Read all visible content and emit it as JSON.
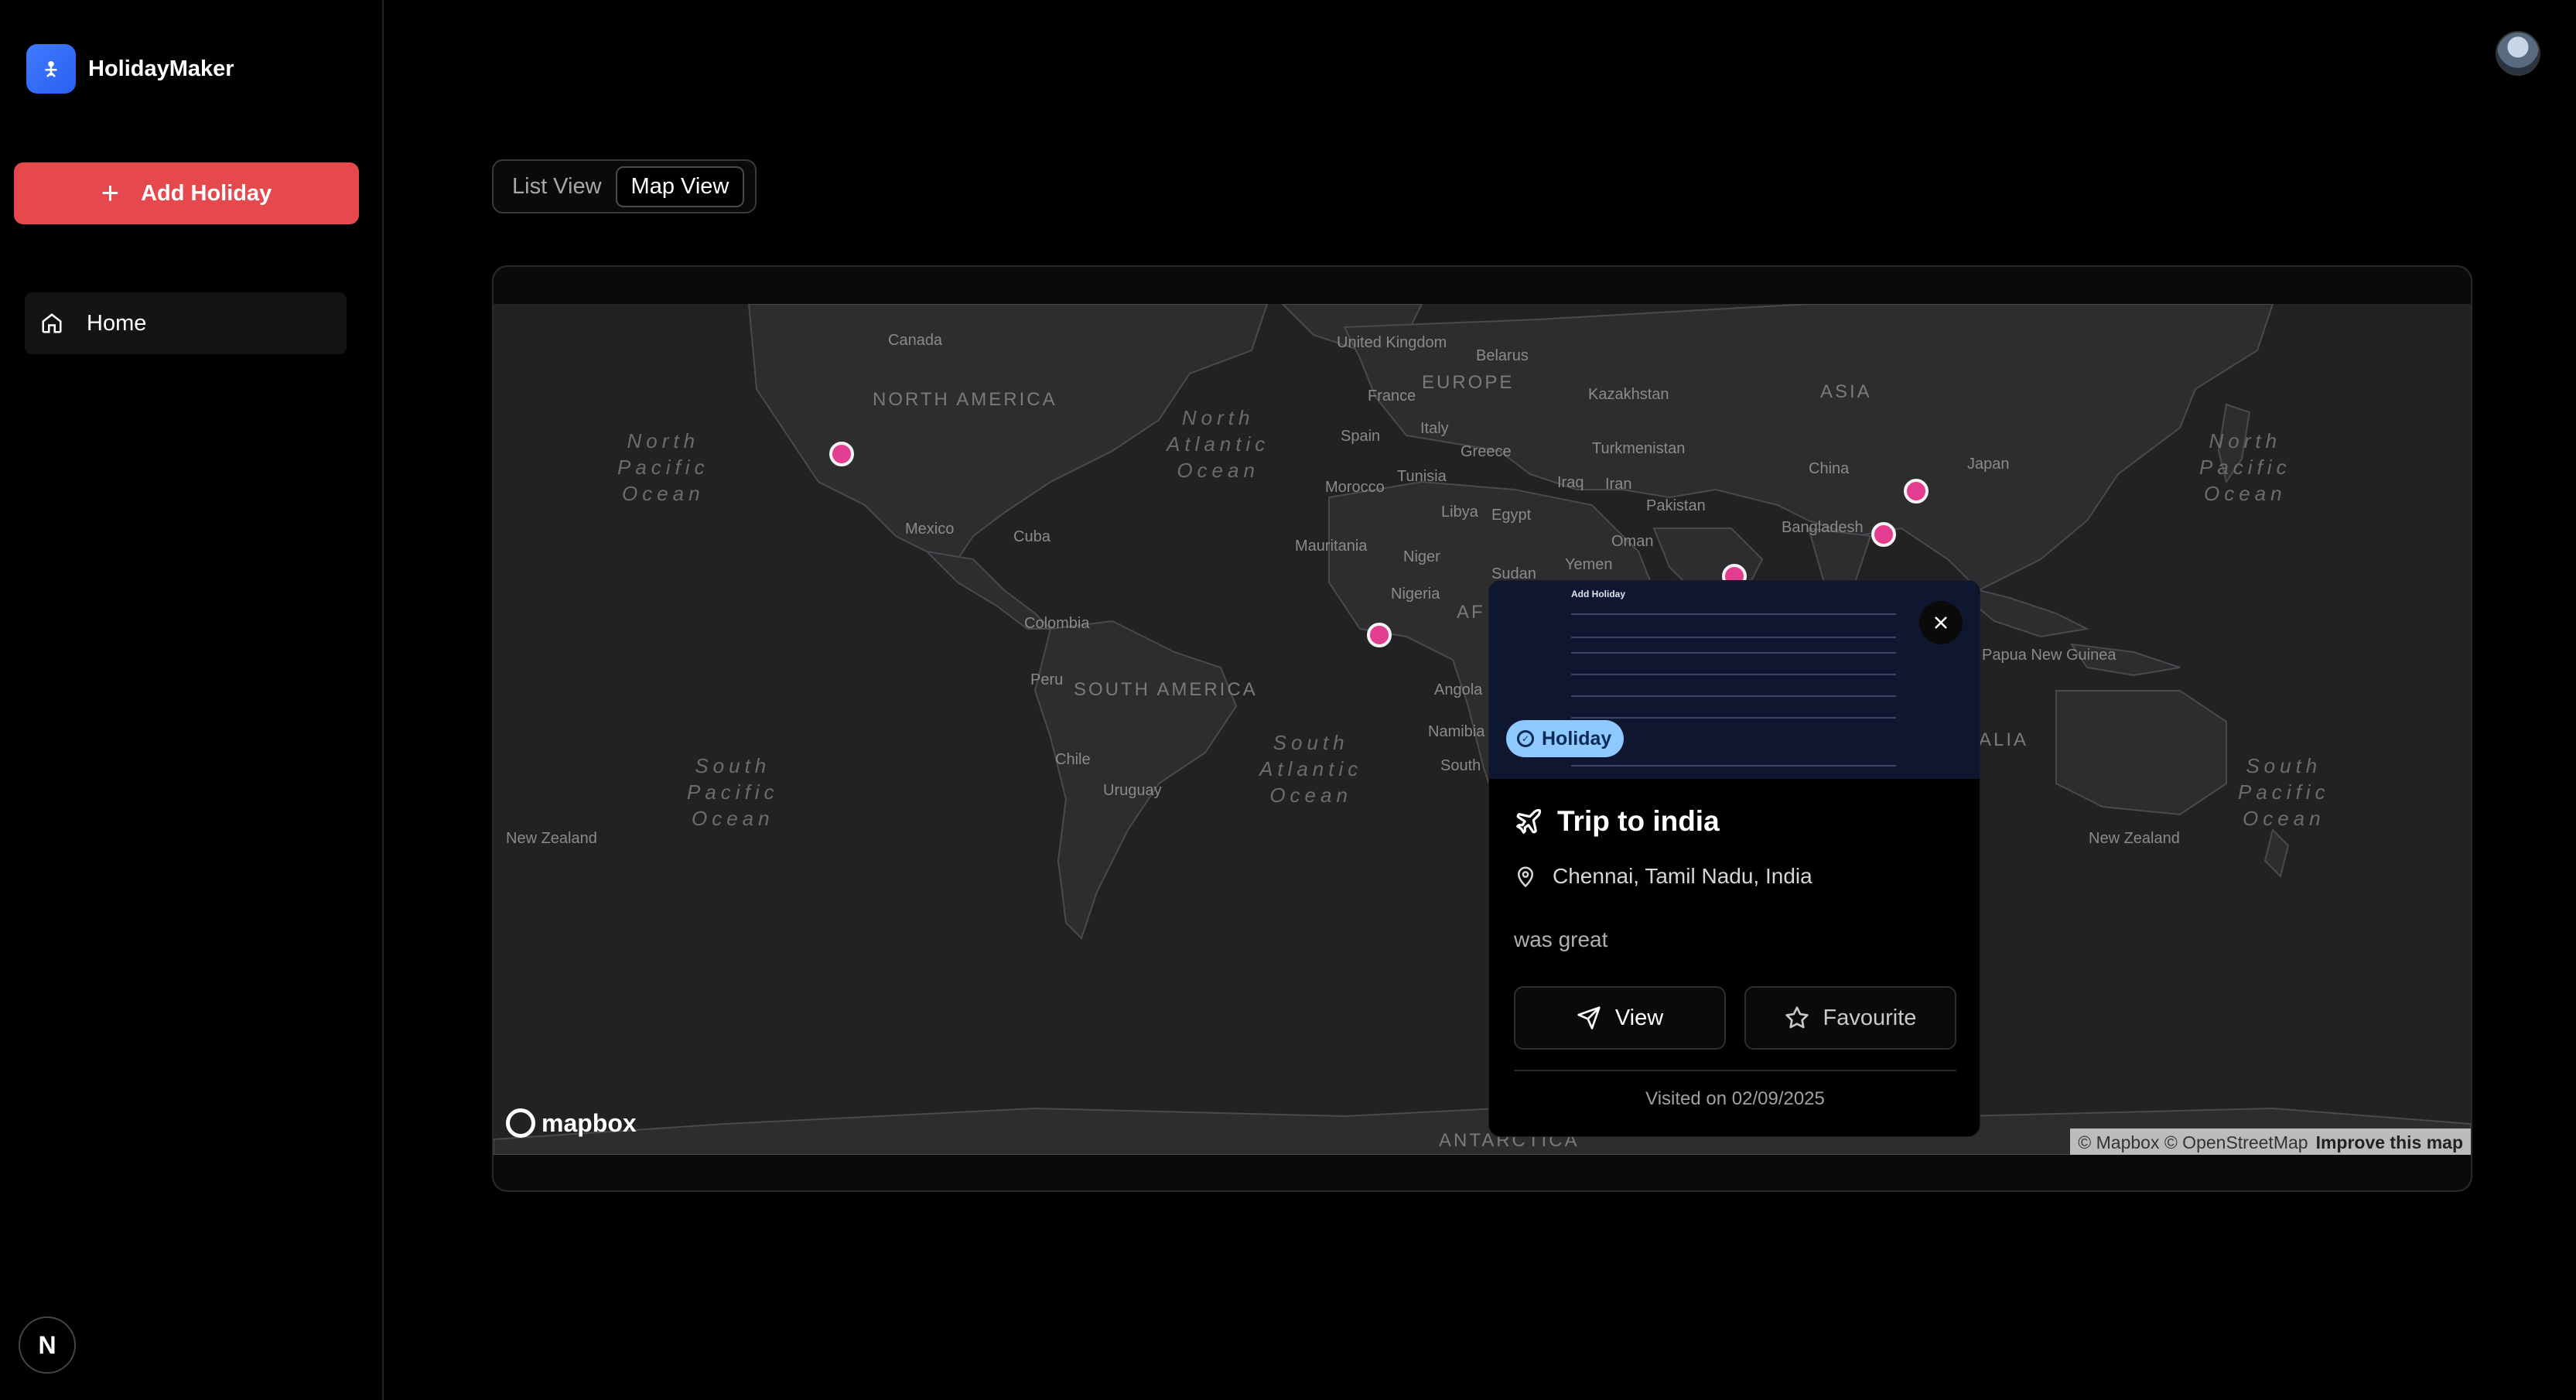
{
  "app": {
    "name": "HolidayMaker"
  },
  "sidebar": {
    "add_button_label": "Add Holiday",
    "nav": [
      {
        "label": "Home",
        "icon": "home-icon",
        "active": true
      }
    ],
    "footer_badge": "N"
  },
  "view_toggle": {
    "tabs": [
      "List View",
      "Map View"
    ],
    "selected": "Map View"
  },
  "map": {
    "countries": [
      "Canada",
      "United Kingdom",
      "Belarus",
      "Kazakhstan",
      "France",
      "Spain",
      "Italy",
      "Greece",
      "Turkmenistan",
      "China",
      "Japan",
      "Morocco",
      "Tunisia",
      "Iraq",
      "Iran",
      "Libya",
      "Egypt",
      "Pakistan",
      "Bangladesh",
      "Mexico",
      "Cuba",
      "Mauritania",
      "Niger",
      "Oman",
      "Sudan",
      "Yemen",
      "Colombia",
      "Nigeria",
      "Peru",
      "Angola",
      "Namibia",
      "Chile",
      "Uruguay",
      "New Zealand",
      "Papua New Guinea",
      "South"
    ],
    "regions": [
      "NORTH AMERICA",
      "EUROPE",
      "ASIA",
      "SOUTH AMERICA",
      "AF",
      "ANTARCTICA",
      "ALIA"
    ],
    "oceans": [
      "North Pacific Ocean",
      "North Atlantic Ocean",
      "South Atlantic Ocean",
      "South Pacific Ocean"
    ],
    "pin_count": 5,
    "pin_color": "#e23d8f",
    "logo_text": "mapbox",
    "attribution": "© Mapbox © OpenStreetMap",
    "improve_link": "Improve this map"
  },
  "popup": {
    "image_caption": "Add Holiday",
    "badge": "Holiday",
    "title": "Trip to india",
    "location": "Chennai, Tamil Nadu, India",
    "description": "was great",
    "view_label": "View",
    "favourite_label": "Favourite",
    "visited": "Visited on 02/09/2025"
  },
  "colors": {
    "accent": "#e5484d",
    "brand": "#3f7bff",
    "badge": "#8ec9ff"
  }
}
